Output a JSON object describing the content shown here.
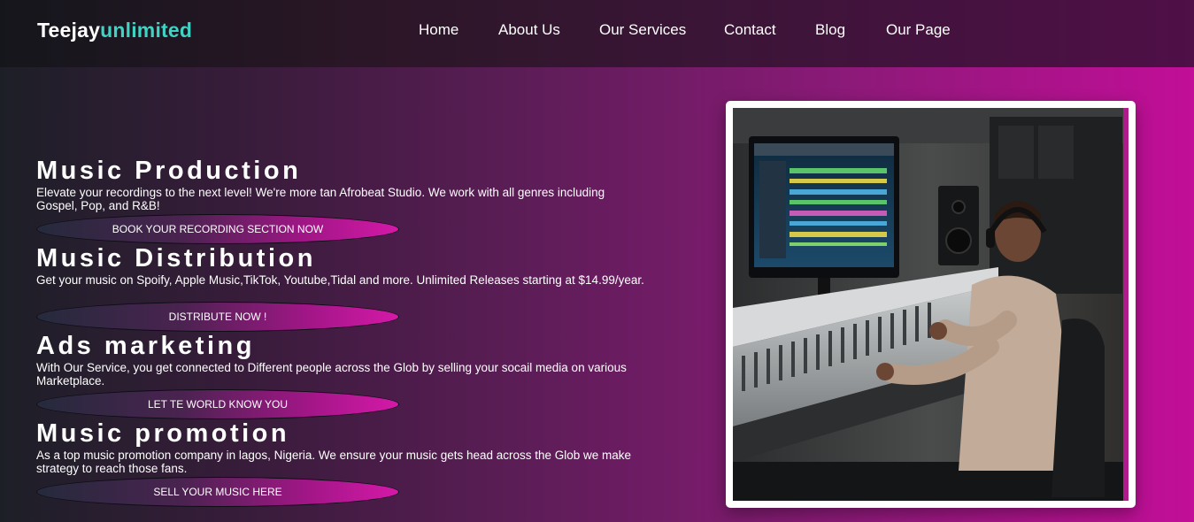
{
  "brand": {
    "part1": "Teejay",
    "part2": "unlimited"
  },
  "nav": {
    "items": [
      "Home",
      "About Us",
      "Our Services",
      "Contact",
      "Blog",
      "Our Page"
    ]
  },
  "services": [
    {
      "title": "Music Production",
      "description": "Elevate your recordings to the next level! We're more tan Afrobeat Studio. We work with all genres including Gospel, Pop, and R&B!",
      "button": "BOOK YOUR RECORDING SECTION NOW"
    },
    {
      "title": "Music Distribution",
      "description": "Get your music on Spoify, Apple Music,TikTok, Youtube,Tidal and more. Unlimited Releases starting at $14.99/year.",
      "button": "DISTRIBUTE NOW !"
    },
    {
      "title": "Ads marketing",
      "description": "With Our Service, you get connected to Different people across the Glob by selling your socail media on various Marketplace.",
      "button": "LET TE WORLD KNOW YOU"
    },
    {
      "title": "Music promotion",
      "description": "As a top music promotion company in lagos, Nigeria. We ensure your music gets head across the Glob we make strategy to reach those fans.",
      "button": "SELL YOUR MUSIC HERE"
    }
  ],
  "colors": {
    "brand_accent": "#3fd3c4",
    "gradient_end": "#c20e98"
  },
  "hero_image": {
    "icon": "studio-engineer-photo"
  }
}
